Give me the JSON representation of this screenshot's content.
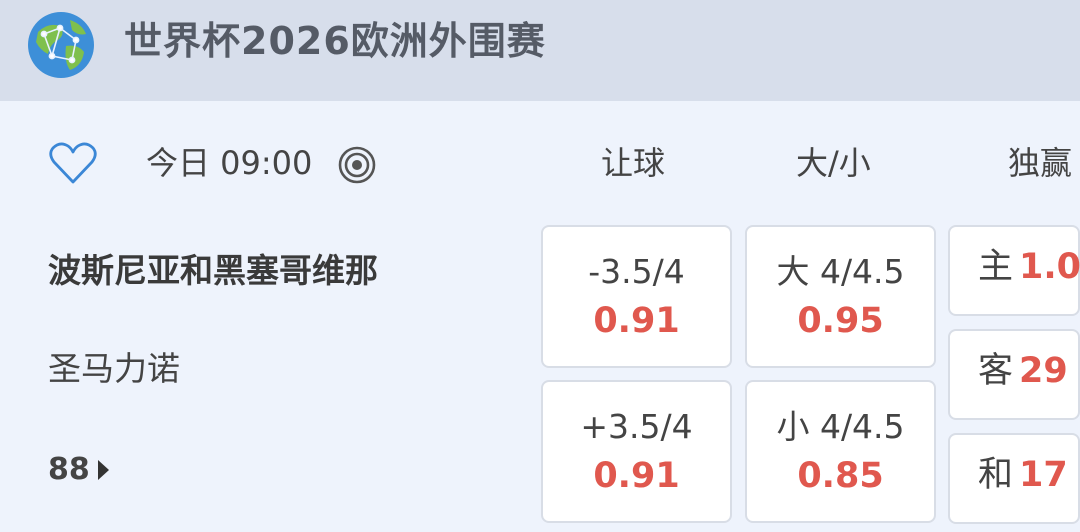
{
  "header": {
    "title": "世界杯2026欧洲外围赛",
    "globe_icon": "globe-icon"
  },
  "match": {
    "time": "今日 09:00",
    "home": "波斯尼亚和黑塞哥维那",
    "away": "圣马力诺",
    "more_count": "88"
  },
  "columns": {
    "handicap": "让球",
    "total": "大/小",
    "moneyline": "独赢"
  },
  "handicap": [
    {
      "line": "-3.5/4",
      "odds": "0.91"
    },
    {
      "line": "+3.5/4",
      "odds": "0.91"
    }
  ],
  "total": [
    {
      "line": "大 4/4.5",
      "odds": "0.95"
    },
    {
      "line": "小 4/4.5",
      "odds": "0.85"
    }
  ],
  "moneyline": [
    {
      "label": "主",
      "odds": "1.0"
    },
    {
      "label": "客",
      "odds": "29"
    },
    {
      "label": "和",
      "odds": "17"
    }
  ],
  "colors": {
    "odds": "#e0584e",
    "header_bg": "#d7deeb",
    "page_bg": "#eef3fc",
    "accent": "#3b87d6"
  }
}
